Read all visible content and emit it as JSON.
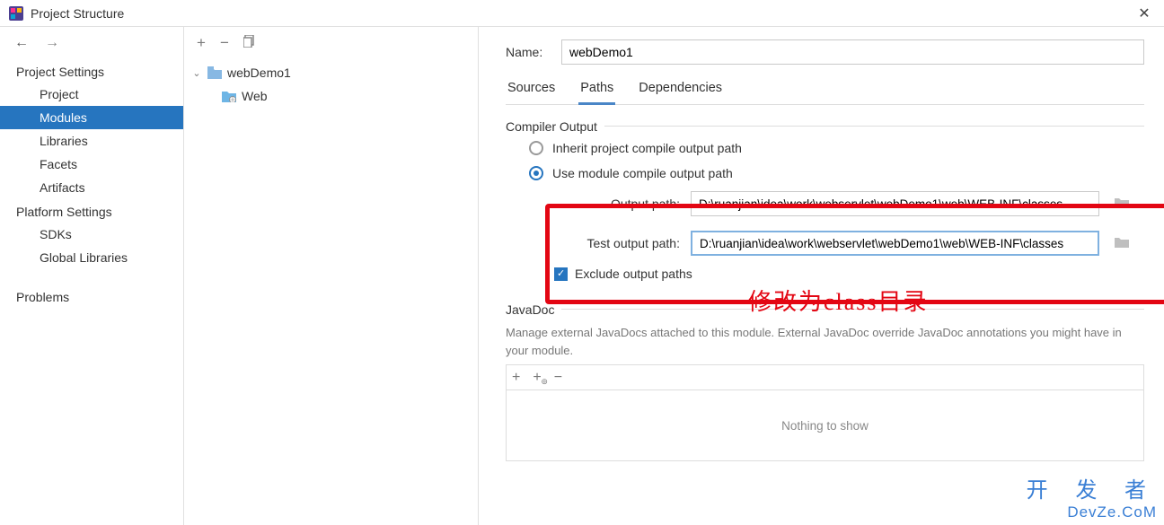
{
  "window": {
    "title": "Project Structure"
  },
  "leftNav": {
    "section1": "Project Settings",
    "items1": [
      "Project",
      "Modules",
      "Libraries",
      "Facets",
      "Artifacts"
    ],
    "active1": 1,
    "section2": "Platform Settings",
    "items2": [
      "SDKs",
      "Global Libraries"
    ],
    "problems": "Problems"
  },
  "tree": {
    "root": "webDemo1",
    "child": "Web"
  },
  "right": {
    "nameLabel": "Name:",
    "nameValue": "webDemo1",
    "tabs": [
      "Sources",
      "Paths",
      "Dependencies"
    ],
    "activeTab": 1,
    "compilerOutput": {
      "title": "Compiler Output",
      "radioInherit": "Inherit project compile output path",
      "radioModule": "Use module compile output path",
      "outputPathLabel": "Output path:",
      "outputPathValue": "D:\\ruanjian\\idea\\work\\webservlet\\webDemo1\\web\\WEB-INF\\classes",
      "testPathLabel": "Test output path:",
      "testPathValue": "D:\\ruanjian\\idea\\work\\webservlet\\webDemo1\\web\\WEB-INF\\classes",
      "excludeLabel": "Exclude output paths"
    },
    "javadoc": {
      "title": "JavaDoc",
      "help": "Manage external JavaDocs attached to this module. External JavaDoc override JavaDoc annotations you might have in your module.",
      "empty": "Nothing to show"
    }
  },
  "annotation": "修改为class目录",
  "watermark": {
    "line1": "开 发 者",
    "line2": "DevZe.CoM"
  }
}
